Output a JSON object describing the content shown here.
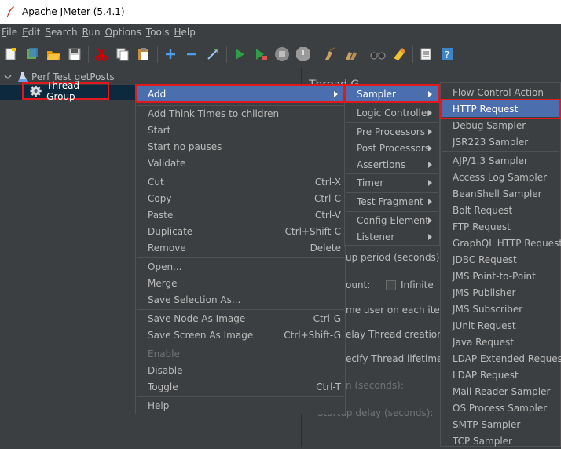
{
  "window": {
    "title": "Apache JMeter (5.4.1)"
  },
  "menubar": [
    {
      "pre": "",
      "u": "F",
      "post": "ile"
    },
    {
      "pre": "",
      "u": "E",
      "post": "dit"
    },
    {
      "pre": "",
      "u": "S",
      "post": "earch"
    },
    {
      "pre": "",
      "u": "R",
      "post": "un"
    },
    {
      "pre": "",
      "u": "O",
      "post": "ptions"
    },
    {
      "pre": "",
      "u": "T",
      "post": "ools"
    },
    {
      "pre": "",
      "u": "H",
      "post": "elp"
    }
  ],
  "tree": {
    "root": "Perf Test getPosts",
    "child": "Thread Group"
  },
  "background_panel": {
    "heading": "Thread G",
    "rampup": "up period (seconds):",
    "loop": "ount:",
    "infinite": "Infinite",
    "same_user": "me user on each iterat",
    "delay": "elay Thread creation ur",
    "lifetime": "ecify Thread lifetime",
    "duration": "n (seconds):",
    "startup": "Startup delay (seconds):"
  },
  "context_menu": {
    "add": "Add",
    "think_times": "Add Think Times to children",
    "start": "Start",
    "start_no_pauses": "Start no pauses",
    "validate": "Validate",
    "cut": "Cut",
    "cut_sc": "Ctrl-X",
    "copy": "Copy",
    "copy_sc": "Ctrl-C",
    "paste": "Paste",
    "paste_sc": "Ctrl-V",
    "duplicate": "Duplicate",
    "duplicate_sc": "Ctrl+Shift-C",
    "remove": "Remove",
    "remove_sc": "Delete",
    "open": "Open...",
    "merge": "Merge",
    "save_selection": "Save Selection As...",
    "save_node_image": "Save Node As Image",
    "save_node_image_sc": "Ctrl-G",
    "save_screen_image": "Save Screen As Image",
    "save_screen_image_sc": "Ctrl+Shift-G",
    "enable": "Enable",
    "disable": "Disable",
    "toggle": "Toggle",
    "toggle_sc": "Ctrl-T",
    "help": "Help"
  },
  "add_submenu": {
    "sampler": "Sampler",
    "logic_controller": "Logic Controller",
    "pre_processors": "Pre Processors",
    "post_processors": "Post Processors",
    "assertions": "Assertions",
    "timer": "Timer",
    "test_fragment": "Test Fragment",
    "config_element": "Config Element",
    "listener": "Listener"
  },
  "sampler_submenu": {
    "items": [
      "Flow Control Action",
      "HTTP Request",
      "Debug Sampler",
      "JSR223 Sampler",
      "AJP/1.3 Sampler",
      "Access Log Sampler",
      "BeanShell Sampler",
      "Bolt Request",
      "FTP Request",
      "GraphQL HTTP Request",
      "JDBC Request",
      "JMS Point-to-Point",
      "JMS Publisher",
      "JMS Subscriber",
      "JUnit Request",
      "Java Request",
      "LDAP Extended Request",
      "LDAP Request",
      "Mail Reader Sampler",
      "OS Process Sampler",
      "SMTP Sampler",
      "TCP Sampler"
    ]
  },
  "colors": {
    "highlight": "#4b6eaf",
    "annotation_red": "#e0191f",
    "background": "#3c3f41"
  }
}
